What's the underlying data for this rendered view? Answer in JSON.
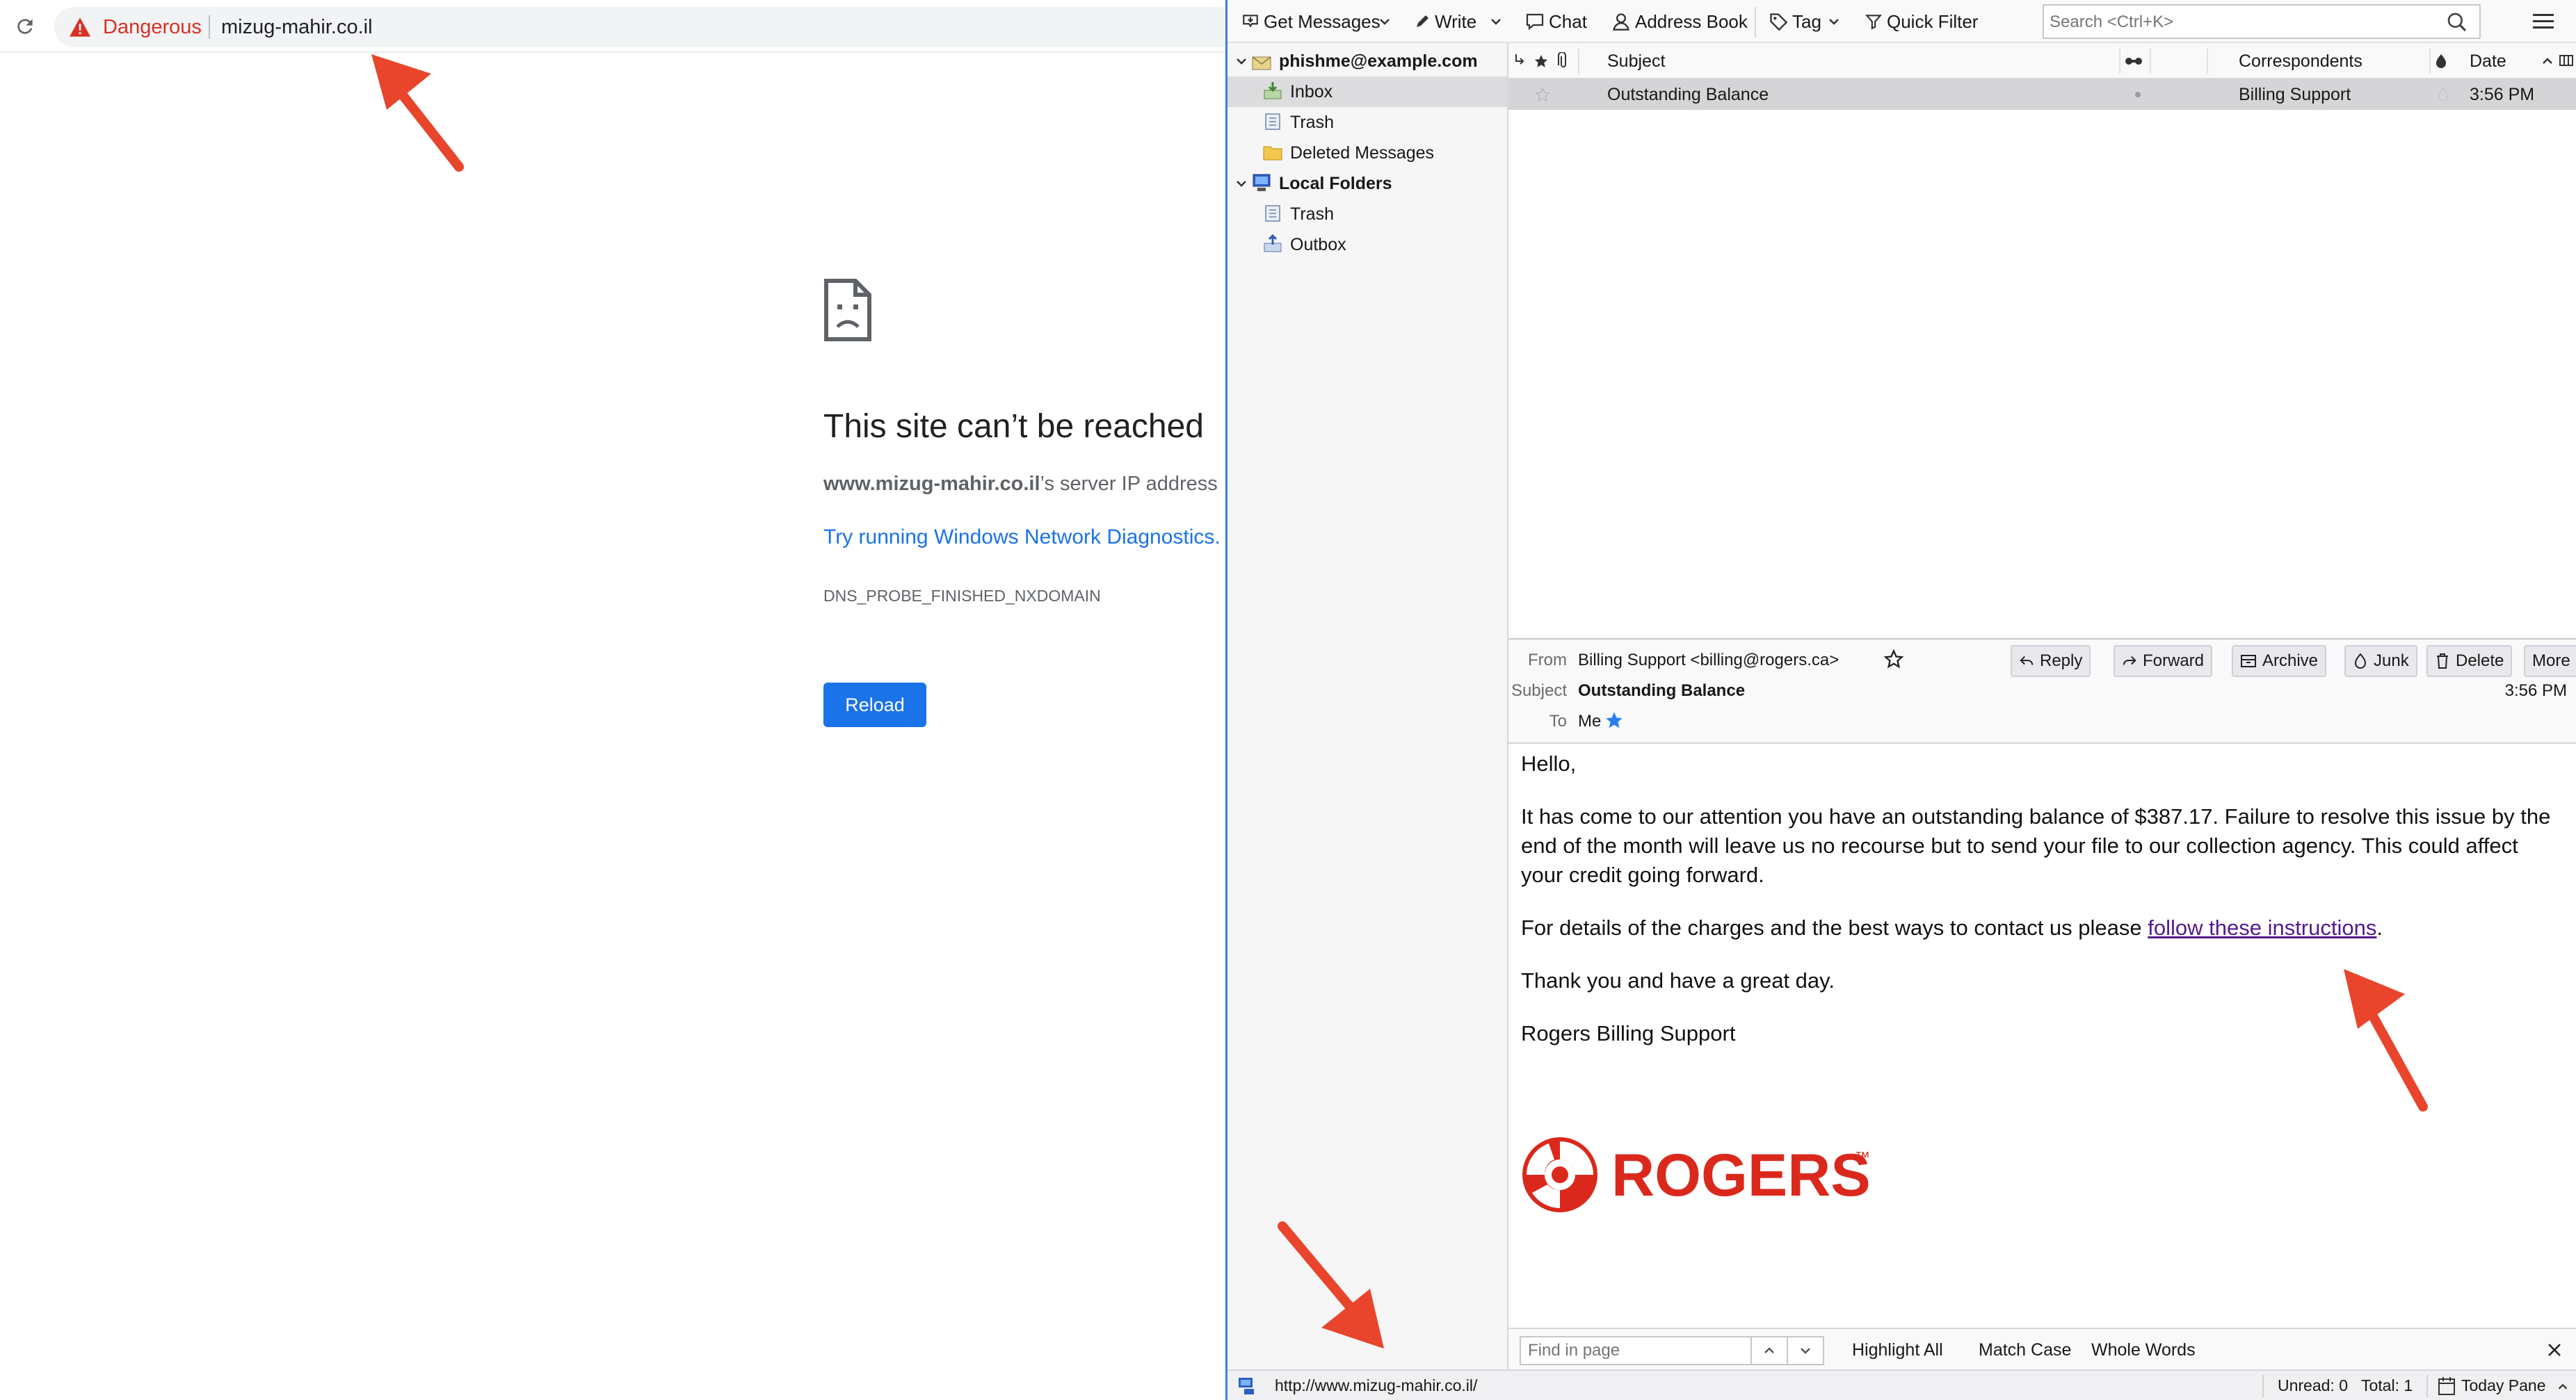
{
  "browser": {
    "security_label": "Dangerous",
    "url": "mizug-mahir.co.il",
    "error": {
      "title": "This site can’t be reached",
      "host": "www.mizug-mahir.co.il",
      "desc_suffix": "’s server IP address",
      "diagnostics_link": "Try running Windows Network Diagnostics.",
      "code": "DNS_PROBE_FINISHED_NXDOMAIN",
      "reload_label": "Reload"
    }
  },
  "mail": {
    "toolbar": {
      "get_messages": "Get Messages",
      "write": "Write",
      "chat": "Chat",
      "address_book": "Address Book",
      "tag": "Tag",
      "quick_filter": "Quick Filter",
      "search_placeholder": "Search <Ctrl+K>"
    },
    "folders": [
      {
        "label": "phishme@example.com",
        "bold": true
      },
      {
        "label": "Inbox"
      },
      {
        "label": "Trash"
      },
      {
        "label": "Deleted Messages"
      },
      {
        "label": "Local Folders",
        "bold": true
      },
      {
        "label": "Trash"
      },
      {
        "label": "Outbox"
      }
    ],
    "columns": {
      "subject": "Subject",
      "correspondents": "Correspondents",
      "date": "Date"
    },
    "messages": [
      {
        "subject": "Outstanding Balance",
        "correspondent": "Billing Support",
        "date": "3:56 PM"
      }
    ],
    "header": {
      "from_label": "From",
      "from_value": "Billing Support <billing@rogers.ca>",
      "subject_label": "Subject",
      "subject_value": "Outstanding Balance",
      "to_label": "To",
      "to_value": "Me",
      "time": "3:56 PM",
      "buttons": {
        "reply": "Reply",
        "forward": "Forward",
        "archive": "Archive",
        "junk": "Junk",
        "delete": "Delete",
        "more": "More"
      }
    },
    "body": {
      "greeting": "Hello,",
      "para1": "It has come to our attention you have an outstanding balance of $387.17. Failure to resolve this issue by the end of the month will leave us no recourse but to send your file to our collection agency. This could affect your credit going forward.",
      "para2_before": "For details of the charges and the best ways to contact us please ",
      "para2_link": "follow these instructions",
      "para2_after": ".",
      "para3": "Thank you and have a great day.",
      "signature": "Rogers Billing Support",
      "logo_text": "ROGERS",
      "logo_tm": "™"
    },
    "find_bar": {
      "placeholder": "Find in page",
      "highlight_all": "Highlight All",
      "match_case": "Match Case",
      "whole_words": "Whole Words"
    },
    "status": {
      "url": "http://www.mizug-mahir.co.il/",
      "unread": "Unread: 0",
      "total": "Total: 1",
      "today_pane": "Today Pane"
    }
  },
  "colors": {
    "danger": "#d93025",
    "link_blue": "#1a73e8",
    "visited_link": "#551a8b",
    "rogers_red": "#da291c",
    "annotation_arrow": "#e8452c"
  }
}
